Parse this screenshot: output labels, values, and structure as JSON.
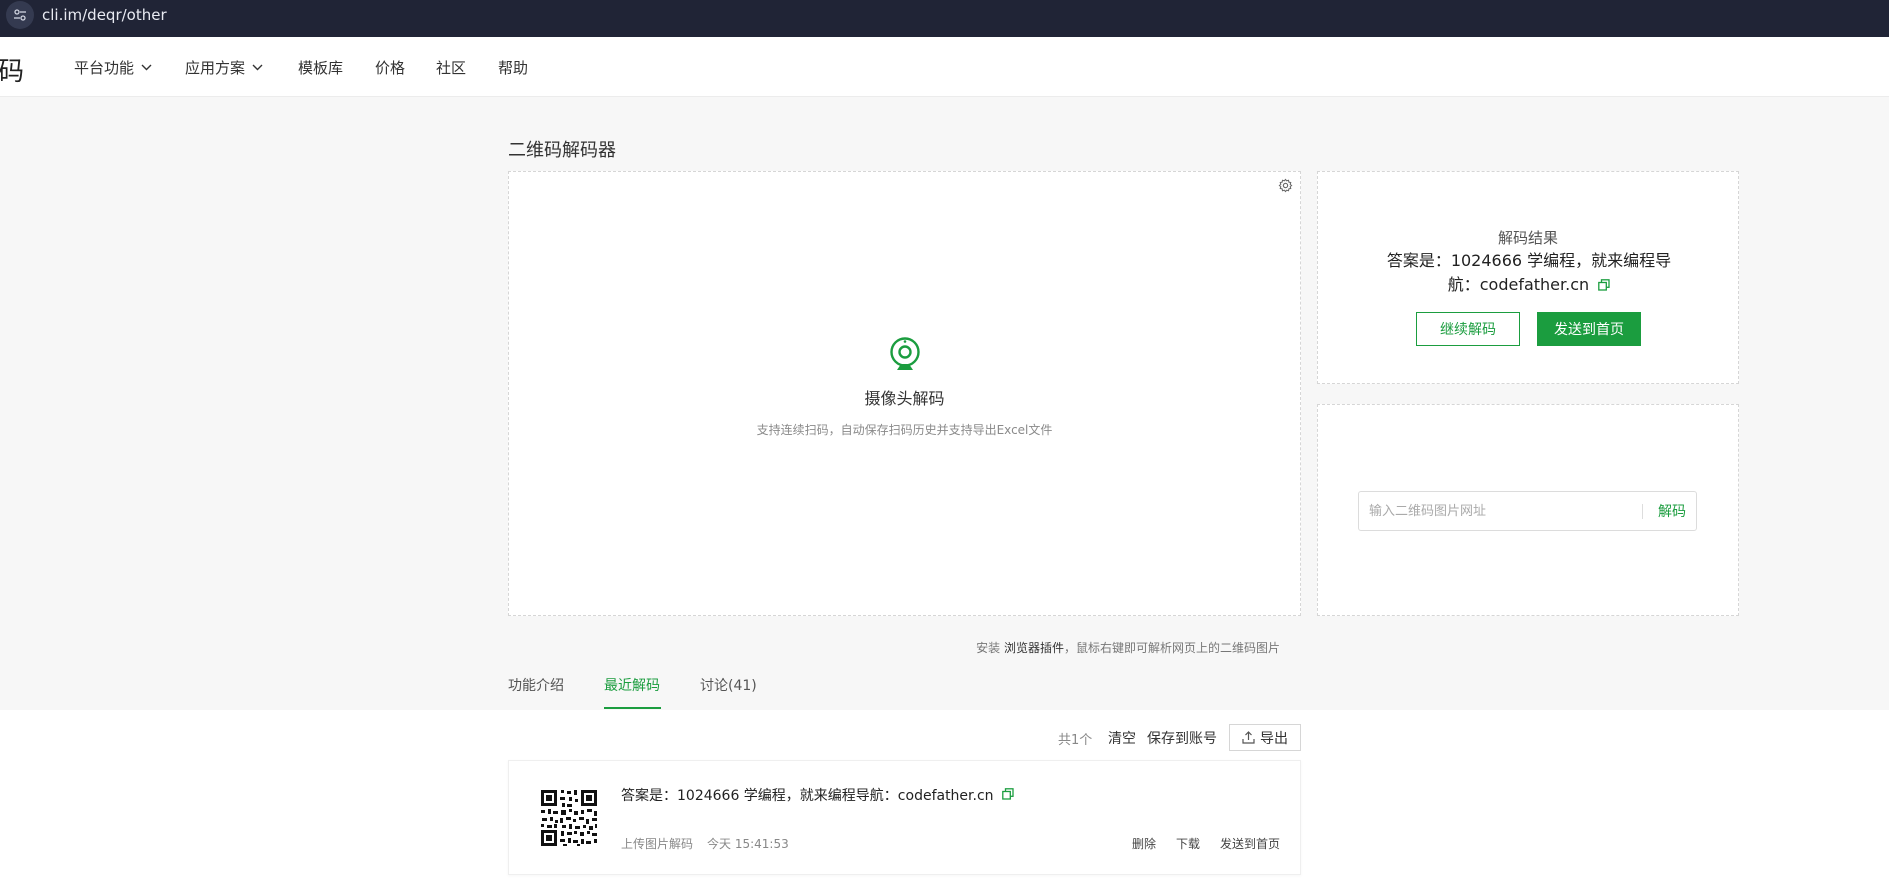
{
  "browser": {
    "url": "cli.im/deqr/other"
  },
  "nav": {
    "brand_char": "码",
    "items": [
      {
        "label": "平台功能",
        "dropdown": true
      },
      {
        "label": "应用方案",
        "dropdown": true
      },
      {
        "label": "模板库",
        "dropdown": false
      },
      {
        "label": "价格",
        "dropdown": false
      },
      {
        "label": "社区",
        "dropdown": false
      },
      {
        "label": "帮助",
        "dropdown": false
      }
    ]
  },
  "page": {
    "title": "二维码解码器"
  },
  "camera": {
    "title": "摄像头解码",
    "subtitle": "支持连续扫码，自动保存扫码历史并支持导出Excel文件"
  },
  "result": {
    "label": "解码结果",
    "text": "答案是：1024666 学编程，就来编程导航：codefather.cn",
    "continue_label": "继续解码",
    "send_label": "发送到首页"
  },
  "url_decode": {
    "placeholder": "输入二维码图片网址",
    "button_label": "解码"
  },
  "plugin_tip": {
    "prefix": "安装",
    "link": "浏览器插件",
    "suffix": "，鼠标右键即可解析网页上的二维码图片"
  },
  "tabs": [
    {
      "label": "功能介绍",
      "active": false
    },
    {
      "label": "最近解码",
      "active": true
    },
    {
      "label": "讨论(41)",
      "active": false
    }
  ],
  "toolbar": {
    "count": "共1个",
    "clear_label": "清空",
    "save_label": "保存到账号",
    "export_label": "导出"
  },
  "history": [
    {
      "text": "答案是：1024666 学编程，就来编程导航：codefather.cn",
      "source": "上传图片解码",
      "time": "今天 15:41:53",
      "actions": [
        "删除",
        "下载",
        "发送到首页"
      ]
    }
  ],
  "colors": {
    "accent": "#1b9d3f",
    "browser_bar": "#202436"
  }
}
